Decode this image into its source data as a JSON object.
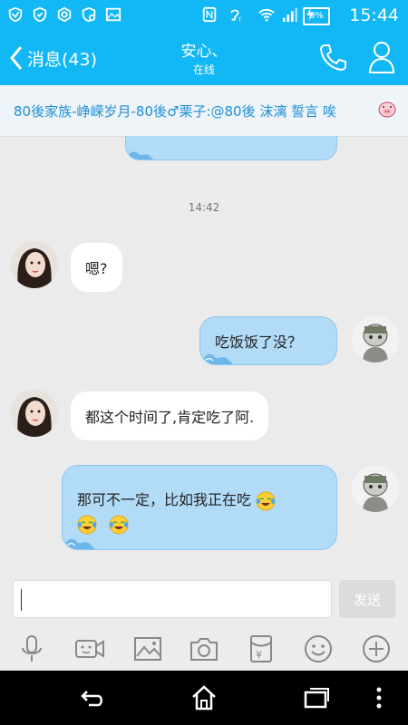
{
  "status_bar": {
    "time": "15:44",
    "battery": "9%",
    "icons": [
      "shield-icon",
      "shield-check-icon",
      "hexagon-icon",
      "shield-settings-icon",
      "image-icon",
      "nfc-icon",
      "hearing-icon",
      "wifi-icon",
      "signal-icon",
      "charging-icon"
    ]
  },
  "header": {
    "back_label": "消息(43)",
    "title": "安心、",
    "subtitle": "在线"
  },
  "banner": {
    "text": "80後家族-峥嵘岁月-80後♂栗子:@80後 沫漓 誓言 唉"
  },
  "messages": {
    "partial_top": "…",
    "timestamp": "14:42",
    "m1": "嗯?",
    "m2": "吃饭饭了没？",
    "m3": "都这个时间了,肯定吃了阿.",
    "m4": "那可不一定，比如我正在吃"
  },
  "input": {
    "value": "",
    "send_label": "发送"
  },
  "toolbar": {
    "icons": [
      "microphone-icon",
      "video-icon",
      "picture-icon",
      "camera-icon",
      "red-packet-icon",
      "emoji-icon",
      "plus-icon"
    ]
  },
  "navbar": {
    "icons": [
      "back-icon",
      "home-icon",
      "recent-apps-icon",
      "menu-icon"
    ]
  },
  "colors": {
    "brand": "#12b7f5",
    "banner_text": "#1f8fd6",
    "outgoing_bubble": "#b2dbf7",
    "incoming_bubble": "#ffffff"
  }
}
